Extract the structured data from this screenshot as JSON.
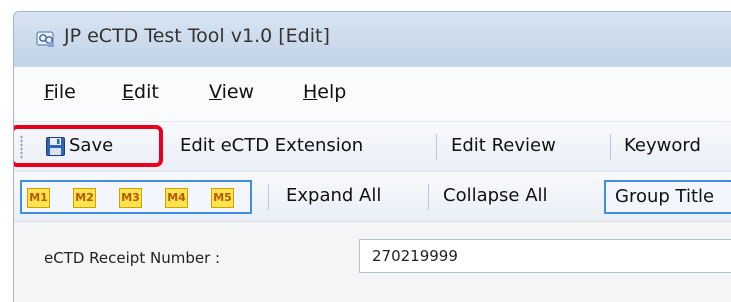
{
  "window": {
    "title": "JP eCTD Test Tool v1.0 [Edit]",
    "icon": "app-tool-icon"
  },
  "menu": [
    {
      "mnemonic": "F",
      "rest": "ile"
    },
    {
      "mnemonic": "E",
      "rest": "dit"
    },
    {
      "mnemonic": "V",
      "rest": "iew"
    },
    {
      "mnemonic": "H",
      "rest": "elp"
    }
  ],
  "toolbar": {
    "save_label": "Save",
    "save_icon": "floppy-disk-icon",
    "edit_extension_label": "Edit eCTD Extension",
    "edit_review_label": "Edit Review",
    "keyword_label": "Keyword",
    "highlight_color": "#e8001c"
  },
  "toolbar2": {
    "modules": [
      "M1",
      "M2",
      "M3",
      "M4",
      "M5"
    ],
    "expand_all_label": "Expand All",
    "collapse_all_label": "Collapse All",
    "group_title_label": "Group Title"
  },
  "form": {
    "receipt_label": "eCTD Receipt Number :",
    "receipt_value": "270219999"
  }
}
